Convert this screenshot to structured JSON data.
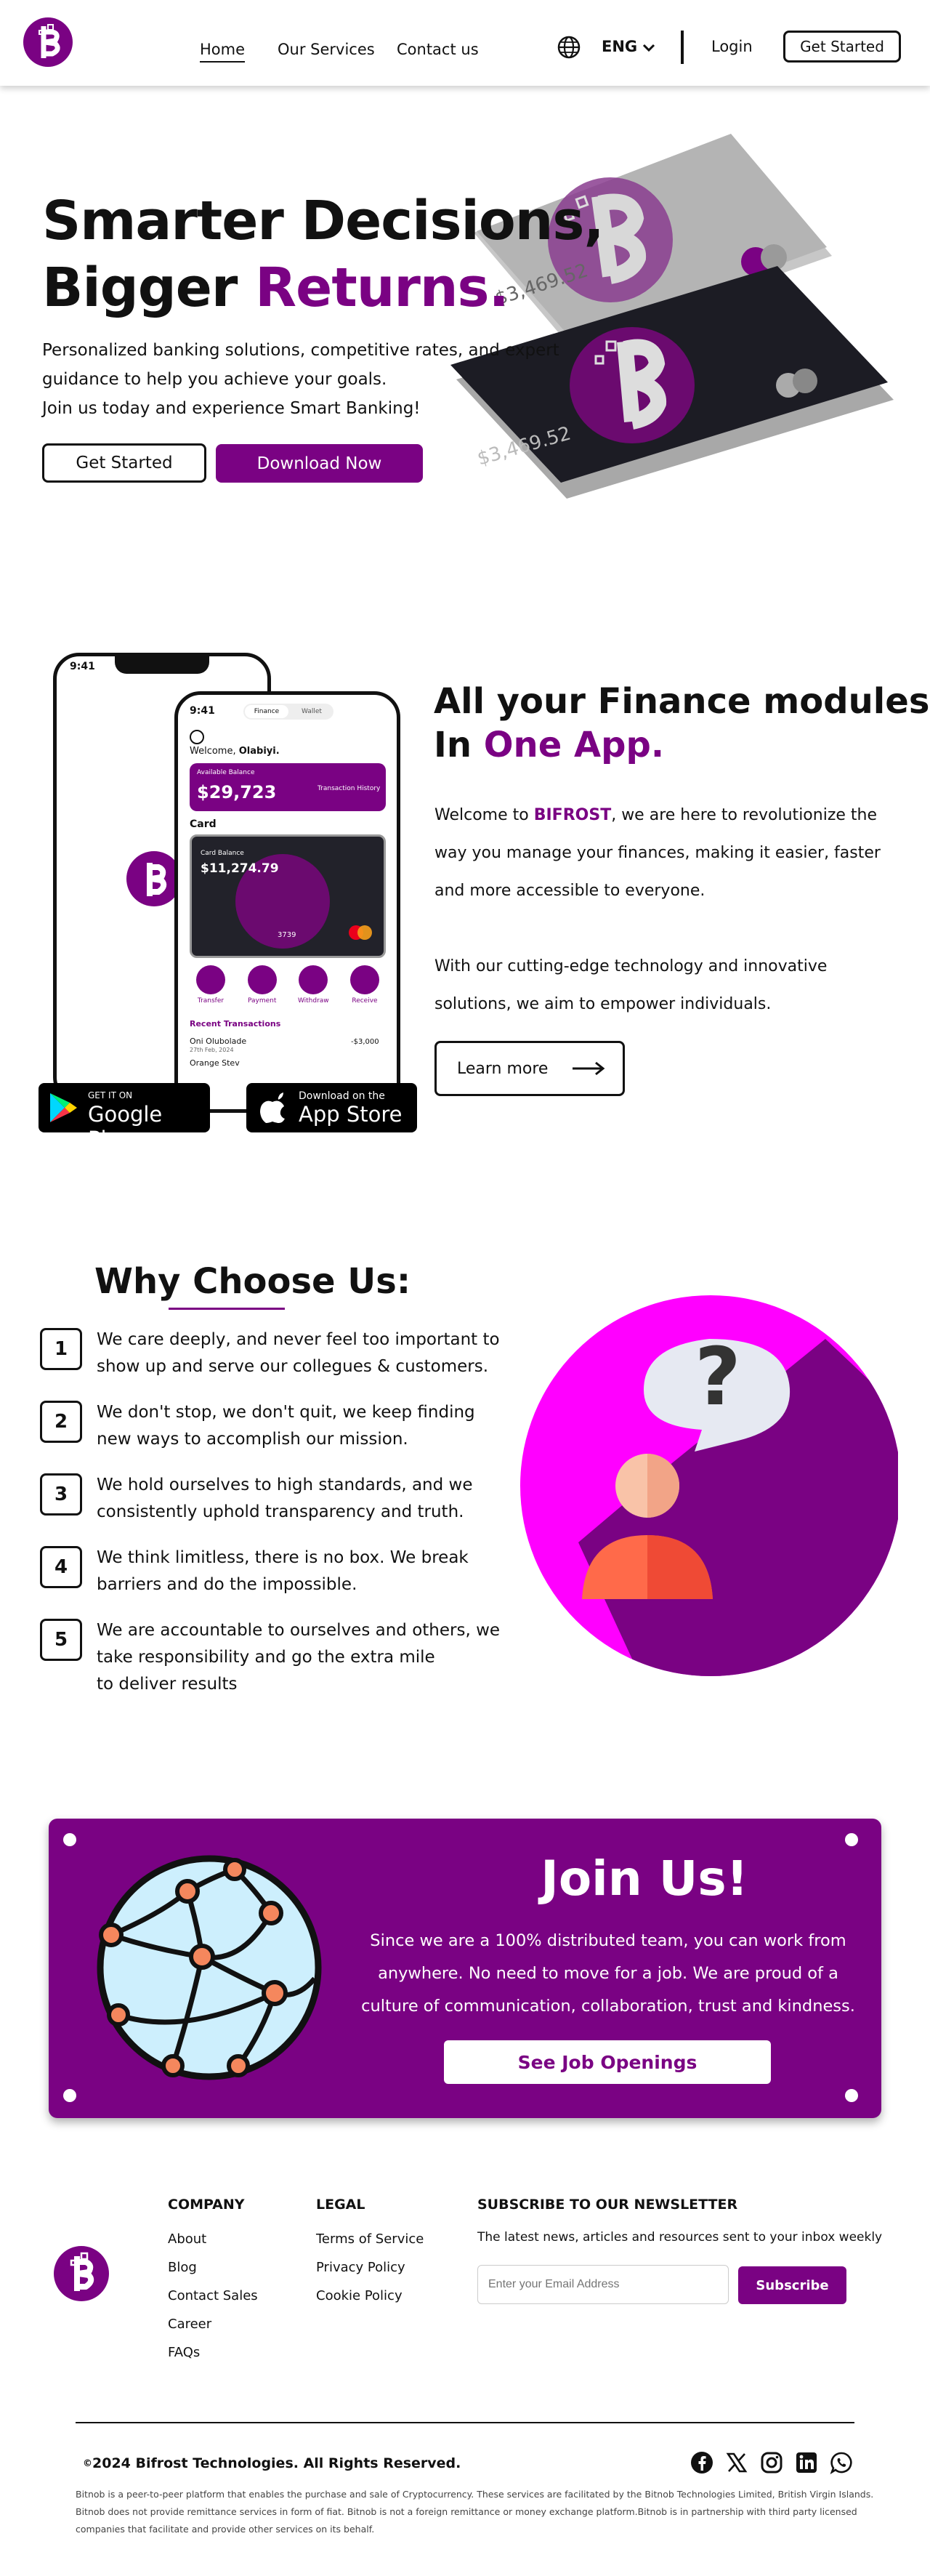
{
  "header": {
    "nav": [
      "Home",
      "Our Services",
      "Contact us"
    ],
    "language": "ENG",
    "login_label": "Login",
    "get_started_label": "Get Started"
  },
  "hero": {
    "title_line1": "Smarter Decisions,",
    "title_line2_plain": "Bigger ",
    "title_line2_accent": "Returns.",
    "body_line1": "Personalized banking solutions, competitive rates, and expert",
    "body_line2": "guidance to help you achieve your goals.",
    "body_line3": "Join us today and experience Smart Banking!",
    "get_started_label": "Get Started",
    "download_label": "Download Now",
    "card_amount_top": "$3,469.52",
    "card_amount_bottom": "$3,469.52"
  },
  "app_section": {
    "title_line1": "All your Finance modules",
    "title_line2_plain": "In ",
    "title_line2_accent": "One App.",
    "para1_prefix": "Welcome to ",
    "para1_brand": "BIFROST",
    "para1_suffix": ", we are here to revolutionize the way you manage your finances, making it easier, faster and more accessible to everyone.",
    "para2": "With our cutting-edge technology and innovative solutions, we aim to empower individuals.",
    "learn_more_label": "Learn more",
    "google_play_small": "GET IT ON",
    "google_play_big": "Google Play",
    "app_store_small": "Download on the",
    "app_store_big": "App Store"
  },
  "phone": {
    "back_time": "9:41",
    "time": "9:41",
    "tab_finance": "Finance",
    "tab_wallet": "Wallet",
    "welcome_prefix": "Welcome, ",
    "welcome_name": "Olabiyi.",
    "available_balance_label": "Available Balance",
    "balance": "$29,723",
    "history_label": "Transaction History",
    "card_label": "Card",
    "card_balance_label": "Card Balance",
    "card_balance": "$11,274.79",
    "card_digits": "3739",
    "actions": [
      "Transfer",
      "Payment",
      "Withdraw",
      "Receive"
    ],
    "recent_label": "Recent Transactions",
    "tx_name": "Oni Olubolade",
    "tx_date": "27th Feb, 2024",
    "tx_amount": "-$3,000",
    "tx_partial": "Orange Stev"
  },
  "why": {
    "title": "Why Choose Us:",
    "reasons": [
      {
        "n": "1",
        "l1": "We care deeply, and never feel too important to",
        "l2": "show up and serve our collegues & customers.",
        "l3": ""
      },
      {
        "n": "2",
        "l1": "We don't stop, we don't quit, we keep finding",
        "l2": "new ways to accomplish our mission.",
        "l3": ""
      },
      {
        "n": "3",
        "l1": "We hold ourselves to high standards, and we",
        "l2": "consistently uphold transparency and truth.",
        "l3": ""
      },
      {
        "n": "4",
        "l1": "We think limitless, there is no box. We break",
        "l2": "barriers and do the impossible.",
        "l3": ""
      },
      {
        "n": "5",
        "l1": "We are accountable to ourselves and others, we",
        "l2": "take responsibility and go the extra mile",
        "l3": "to deliver results"
      }
    ]
  },
  "join": {
    "title": "Join Us!",
    "line1": "Since we are a 100% distributed team, you can work  from",
    "line2": "anywhere. No need to move for a job. We are proud of a",
    "line3": "culture of communication, collaboration, trust and kindness.",
    "button": "See Job Openings"
  },
  "footer": {
    "company_head": "COMPANY",
    "company_links": [
      "About",
      "Blog",
      "Contact Sales",
      "Career",
      "FAQs"
    ],
    "legal_head": "LEGAL",
    "legal_links": [
      "Terms of Service",
      "Privacy Policy",
      "Cookie Policy"
    ],
    "newsletter_head": "SUBSCRIBE TO OUR NEWSLETTER",
    "newsletter_text": "The latest news, articles and resources sent to your inbox weekly",
    "email_placeholder": "Enter your Email Address",
    "subscribe_label": "Subscribe",
    "copyright_symbol": "©",
    "copyright": "2024 Bifrost Technologies. All Rights Reserved.",
    "disclaimer1": "Bitnob is a peer-to-peer platform that enables the purchase and sale of Cryptocurrency. These services are facilitated by the Bitnob Technologies Limited, British Virgin Islands.",
    "disclaimer2": "Bitnob does not provide remittance services in form of fiat. Bitnob is not a foreign remittance or money exchange platform.Bitnob is in partnership with third party licensed",
    "disclaimer3": "companies that facilitate and provide other services on its behalf."
  },
  "colors": {
    "brand": "#7a0283",
    "magenta": "#ff00ff",
    "card_dark": "#1c1c24"
  },
  "icons": [
    "bifrost-logo-icon",
    "globe-language-icon",
    "chevron-down-icon",
    "arrow-right-icon",
    "google-play-icon",
    "apple-icon",
    "help-person-icon",
    "network-globe-icon",
    "facebook-icon",
    "x-icon",
    "instagram-icon",
    "linkedin-icon",
    "whatsapp-icon"
  ]
}
